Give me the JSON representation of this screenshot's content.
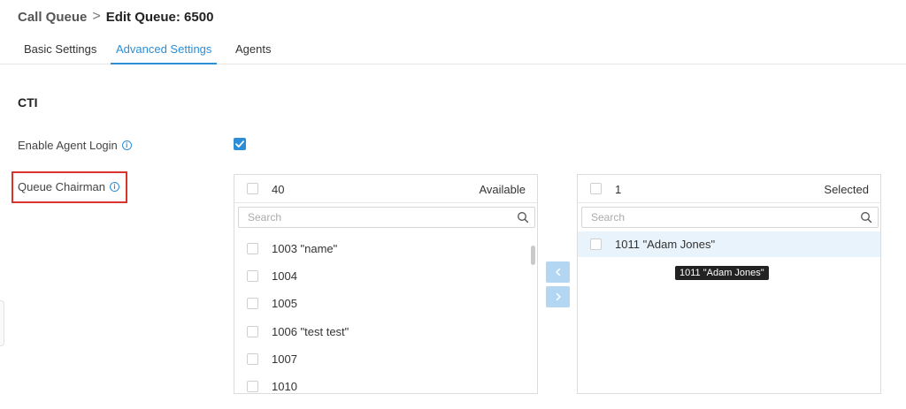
{
  "breadcrumb": {
    "parent": "Call Queue",
    "separator": ">",
    "current": "Edit Queue: 6500"
  },
  "tabs": [
    {
      "label": "Basic Settings",
      "active": false
    },
    {
      "label": "Advanced Settings",
      "active": true
    },
    {
      "label": "Agents",
      "active": false
    }
  ],
  "section": {
    "title": "CTI"
  },
  "fields": {
    "enable_agent_login": {
      "label": "Enable Agent Login",
      "checked": true
    },
    "queue_chairman": {
      "label": "Queue Chairman"
    }
  },
  "available_panel": {
    "count": "40",
    "title": "Available",
    "search_placeholder": "Search",
    "items": [
      "1003 \"name\"",
      "1004",
      "1005",
      "1006 \"test test\"",
      "1007",
      "1010"
    ]
  },
  "selected_panel": {
    "count": "1",
    "title": "Selected",
    "search_placeholder": "Search",
    "items": [
      "1011 \"Adam Jones\""
    ]
  },
  "tooltip": {
    "text": "1011 \"Adam Jones\""
  },
  "colors": {
    "accent": "#2b8ed6",
    "highlight_border": "#d9342b",
    "transfer_button": "#b3d7f3",
    "selected_row": "#e9f3fb"
  }
}
